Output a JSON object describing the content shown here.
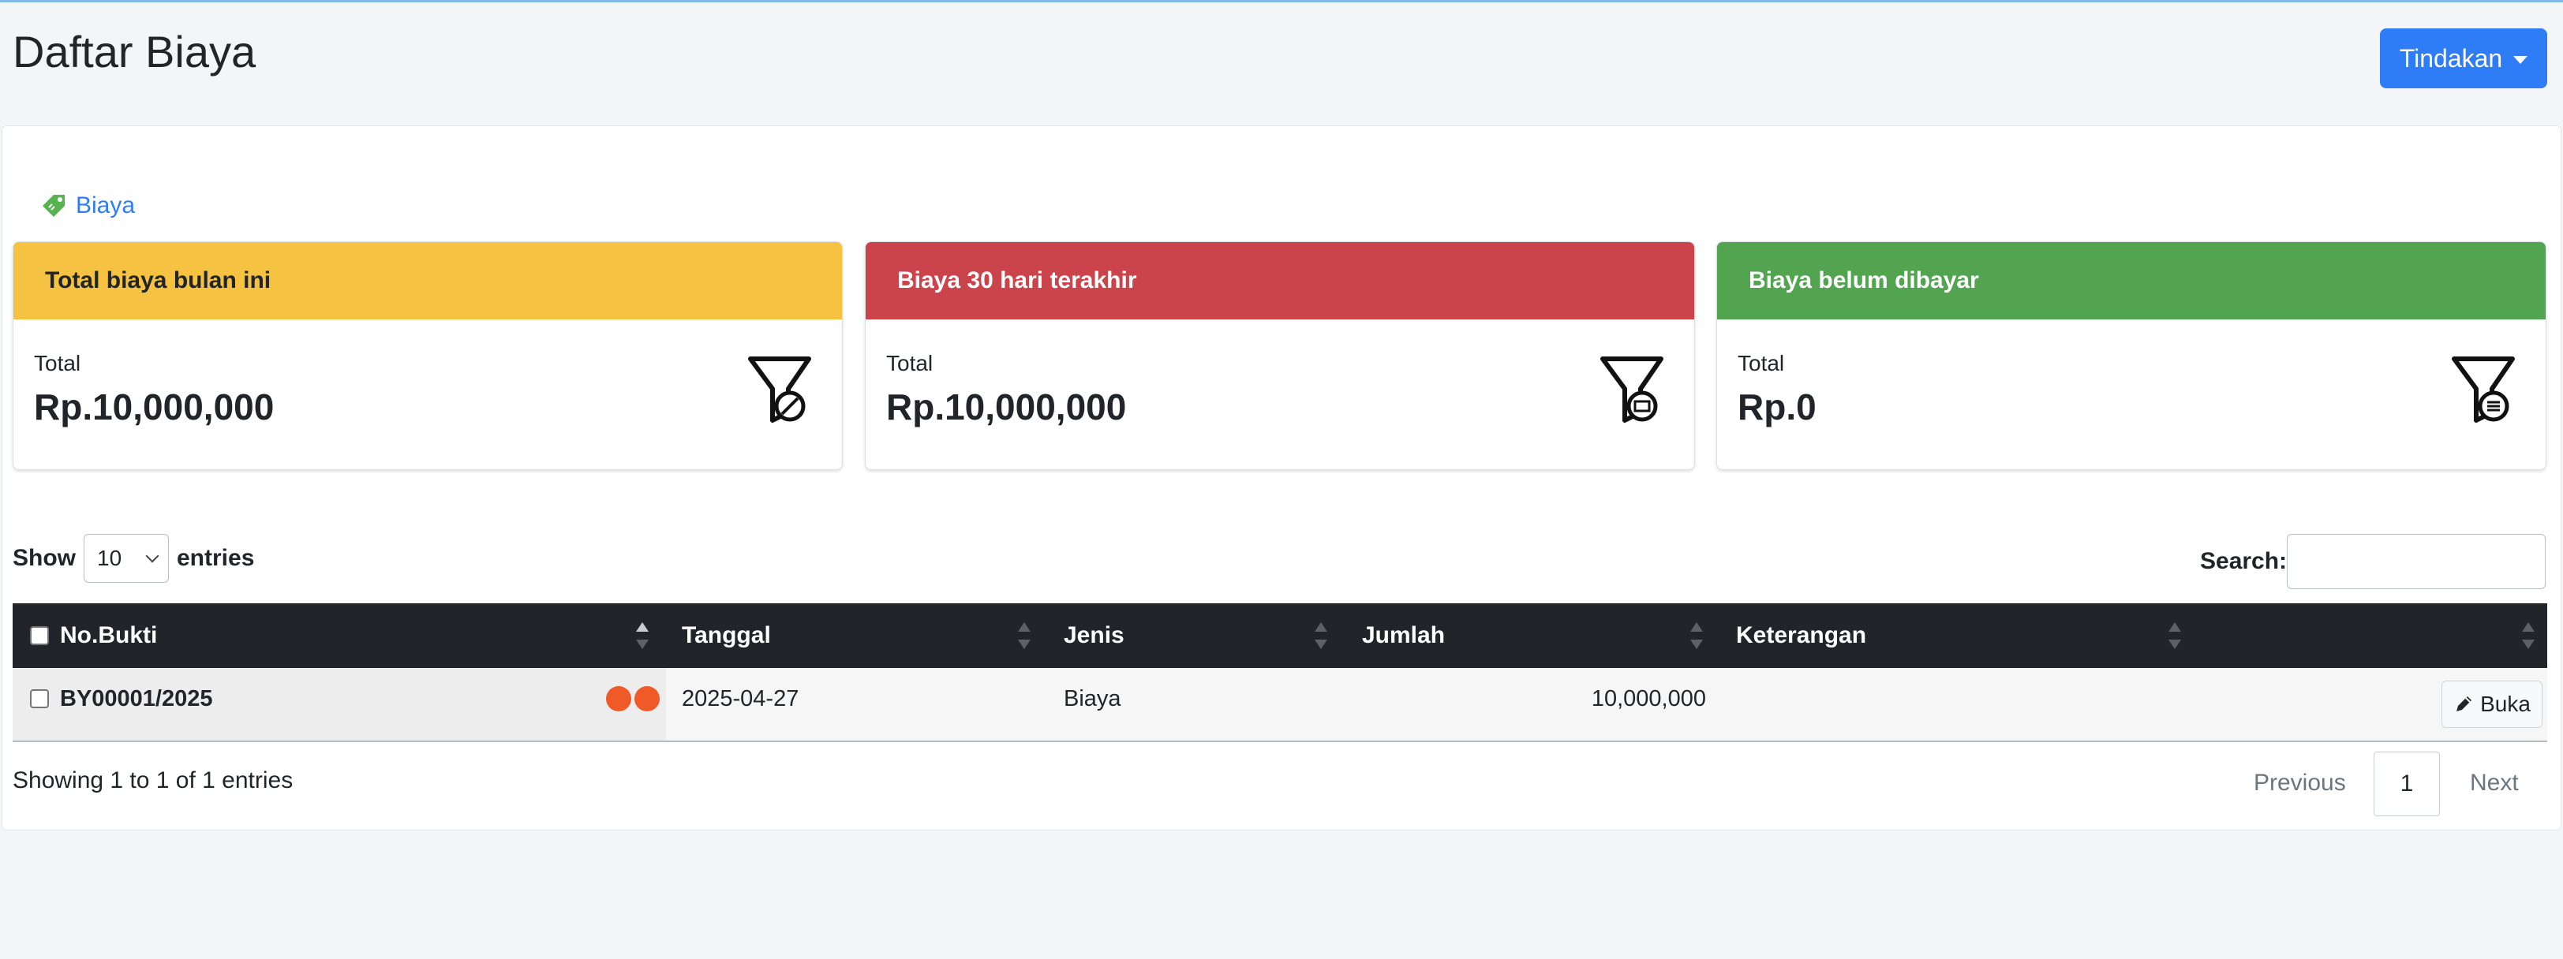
{
  "header": {
    "title": "Daftar Biaya",
    "action_label": "Tindakan"
  },
  "tab": {
    "label": "Biaya"
  },
  "cards": [
    {
      "title": "Total biaya bulan ini",
      "label": "Total",
      "value": "Rp.10,000,000",
      "color": "#f5c242",
      "text_color": "#212529"
    },
    {
      "title": "Biaya 30 hari terakhir",
      "label": "Total",
      "value": "Rp.10,000,000",
      "color": "#cc444b",
      "text_color": "#ffffff"
    },
    {
      "title": "Biaya belum dibayar",
      "label": "Total",
      "value": "Rp.0",
      "color": "#52a450",
      "text_color": "#ffffff"
    }
  ],
  "table_controls": {
    "show": "Show",
    "page_size": "10",
    "entries": "entries",
    "search_label": "Search:"
  },
  "columns": [
    "No.Bukti",
    "Tanggal",
    "Jenis",
    "Jumlah",
    "Keterangan"
  ],
  "rows": [
    {
      "no_bukti": "BY00001/2025",
      "tanggal": "2025-04-27",
      "jenis": "Biaya",
      "jumlah": "10,000,000",
      "keterangan": "",
      "open_label": "Buka"
    }
  ],
  "footer": {
    "info": "Showing 1 to 1 of 1 entries",
    "previous": "Previous",
    "page": "1",
    "next": "Next"
  },
  "colors": {
    "accent": "#2f7df6",
    "table_head": "#212529",
    "status_dot": "#f05a28"
  }
}
